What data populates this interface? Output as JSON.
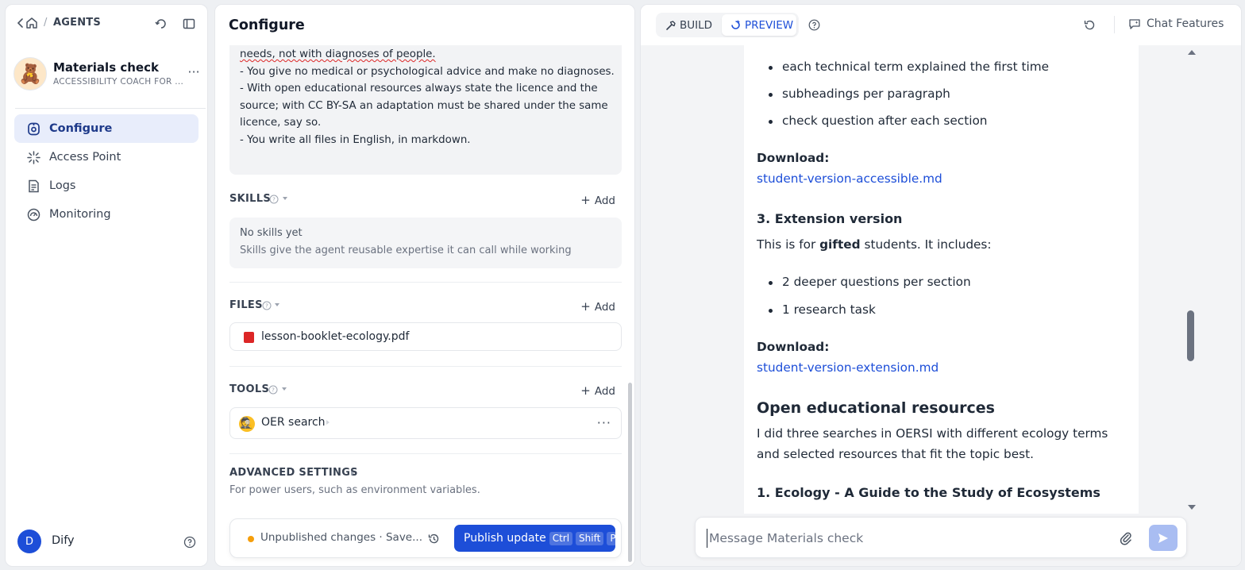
{
  "sidebar": {
    "breadcrumb": "AGENTS",
    "agent": {
      "name": "Materials check",
      "subtitle": "ACCESSIBILITY COACH FOR ..."
    },
    "nav": [
      {
        "label": "Configure",
        "icon": "configure-icon",
        "active": true
      },
      {
        "label": "Access Point",
        "icon": "access-point-icon",
        "active": false
      },
      {
        "label": "Logs",
        "icon": "logs-icon",
        "active": false
      },
      {
        "label": "Monitoring",
        "icon": "monitoring-icon",
        "active": false
      }
    ],
    "user": {
      "initial": "D",
      "name": "Dify"
    }
  },
  "configure": {
    "title": "Configure",
    "prompt_lines": [
      "needs, not with diagnoses of people.",
      "- You give no medical or psychological advice and make no diagnoses.",
      "- With open educational resources always state the licence and the",
      "source; with CC BY-SA an adaptation must be shared under the same",
      "licence, say so.",
      "- You write all files in English, in markdown."
    ],
    "skills": {
      "title": "SKILLS",
      "add_label": "Add",
      "empty_title": "No skills yet",
      "empty_desc": "Skills give the agent reusable expertise it can call while working"
    },
    "files": {
      "title": "FILES",
      "add_label": "Add",
      "items": [
        "lesson-booklet-ecology.pdf"
      ]
    },
    "tools": {
      "title": "TOOLS",
      "add_label": "Add",
      "items": [
        {
          "name": "OER search"
        }
      ]
    },
    "advanced": {
      "title": "ADVANCED SETTINGS",
      "description": "For power users, such as environment variables."
    },
    "publish": {
      "status": "Unpublished changes · Save...",
      "button_label": "Publish update",
      "shortcut": [
        "Ctrl",
        "Shift",
        "P"
      ]
    }
  },
  "preview": {
    "mode_build": "BUILD",
    "mode_preview": "PREVIEW",
    "chat_features": "Chat Features",
    "messages": {
      "bullets_top": [
        "each technical term explained the first time",
        "subheadings per paragraph",
        "check question after each section"
      ],
      "download_label_1": "Download:",
      "download_link_1": "student-version-accessible.md",
      "heading_ext": "3. Extension version",
      "ext_intro_a": "This is for ",
      "ext_intro_bold": "gifted",
      "ext_intro_b": " students. It includes:",
      "bullets_ext": [
        "2 deeper questions per section",
        "1 research task"
      ],
      "download_label_2": "Download:",
      "download_link_2": "student-version-extension.md",
      "heading_oer": "Open educational resources",
      "oer_para_1": "I did three searches in OERSI with different ecology terms",
      "oer_para_2": "and selected resources that fit the topic best.",
      "heading_res1": "1. Ecology - A Guide to the Study of Ecosystems"
    },
    "input_placeholder": "Message Materials check"
  },
  "colors": {
    "accent": "#1d4ed8",
    "status_dot": "#f59e0b",
    "nav_active_bg": "#e8edfb"
  }
}
